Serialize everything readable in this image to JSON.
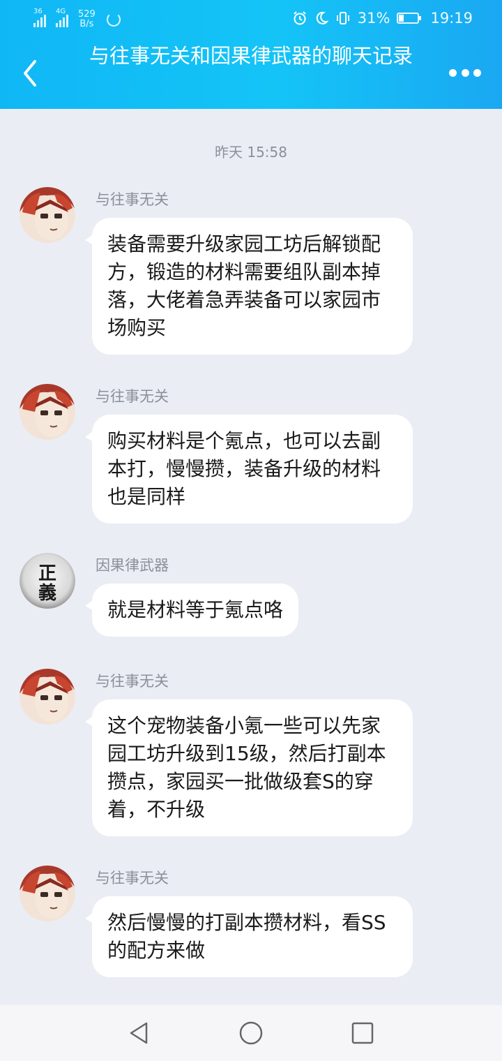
{
  "status_bar": {
    "network_1": "36",
    "network_2": "4G",
    "speed_value": "529",
    "speed_unit": "B/s",
    "battery": "31%",
    "battery_level": 0.31,
    "time": "19:19"
  },
  "header": {
    "title": "与往事无关和因果律武器的聊天记录"
  },
  "chat": {
    "timestamp": "昨天 15:58",
    "messages": [
      {
        "sender": "与往事无关",
        "avatar": "anime-avatar",
        "text": "装备需要升级家园工坊后解锁配方，锻造的材料需要组队副本掉落，大佬着急弄装备可以家园市场购买"
      },
      {
        "sender": "与往事无关",
        "avatar": "anime-avatar",
        "text": "购买材料是个氪点，也可以去副本打，慢慢攒，装备升级的材料也是同样"
      },
      {
        "sender": "因果律武器",
        "avatar": "calligraphy-avatar",
        "avatar_text": "正義",
        "text": "就是材料等于氪点咯"
      },
      {
        "sender": "与往事无关",
        "avatar": "anime-avatar",
        "text": "这个宠物装备小氪一些可以先家园工坊升级到15级，然后打副本攒点，家园买一批做级套S的穿着，不升级"
      },
      {
        "sender": "与往事无关",
        "avatar": "anime-avatar",
        "text": "然后慢慢的打副本攒材料，看SS的配方来做"
      }
    ]
  },
  "colors": {
    "header_gradient_start": "#10b7f5",
    "header_gradient_end": "#1aa8f2",
    "chat_background": "#eaedf4",
    "bubble": "#ffffff"
  },
  "icons": {
    "back": "chevron-left-icon",
    "more": "more-dots-icon",
    "nav_back": "triangle-back-icon",
    "nav_home": "circle-home-icon",
    "nav_recent": "square-recent-icon"
  }
}
